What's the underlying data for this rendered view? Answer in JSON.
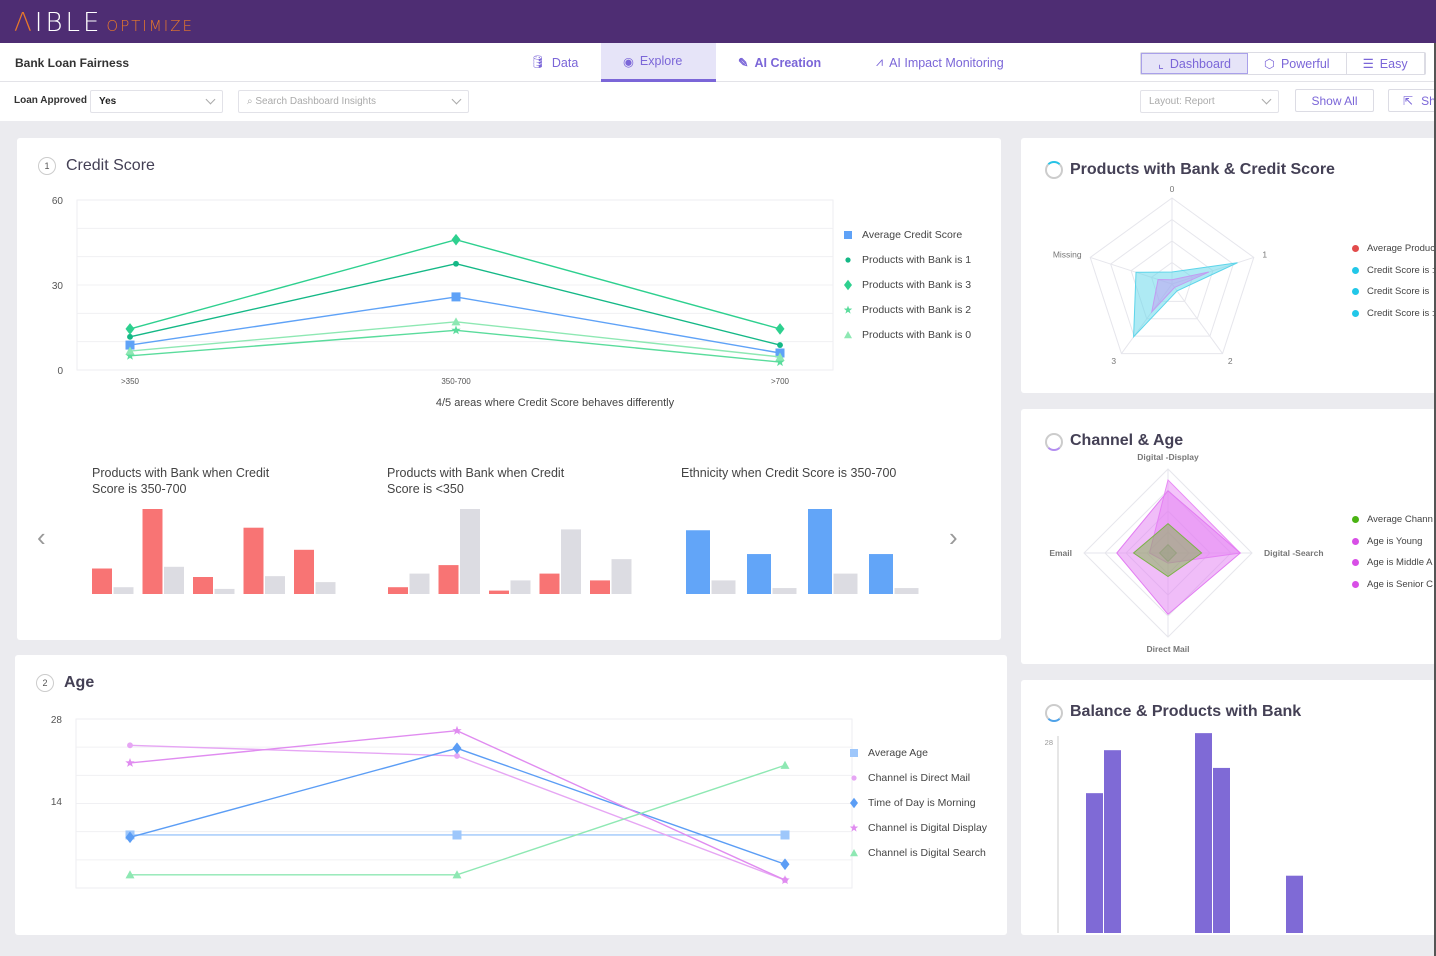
{
  "app": {
    "logo_main": "AIBLE",
    "logo_sub": "OPTIMIZE",
    "project": "Bank Loan Fairness"
  },
  "nav": [
    {
      "label": "Data",
      "icon": "database-icon"
    },
    {
      "label": "Explore",
      "icon": "compass-icon",
      "active": true
    },
    {
      "label": "AI Creation",
      "icon": "magic-wand-icon"
    },
    {
      "label": "AI Impact Monitoring",
      "icon": "pulse-icon"
    }
  ],
  "modes": [
    {
      "label": "Dashboard",
      "active": true
    },
    {
      "label": "Powerful"
    },
    {
      "label": "Easy"
    }
  ],
  "filters": {
    "label": "Loan Approved",
    "value": "Yes",
    "search_placeholder": "Search Dashboard Insights",
    "layout": "Layout: Report",
    "show_all": "Show All",
    "share": "Sh"
  },
  "colors": {
    "header": "#4e2d73",
    "accent": "#7b66d8",
    "accent_orange": "#e8782a"
  },
  "credit": {
    "num": "1",
    "title": "Credit Score",
    "subtitle": "4/5 areas where Credit Score behaves differently",
    "mini": [
      {
        "title1": "Products with Bank when Credit",
        "title2": "Score is 350-700"
      },
      {
        "title1": "Products with Bank when Credit",
        "title2": "Score is <350"
      },
      {
        "title1": "Ethnicity when Credit Score is 350-700",
        "title2": ""
      }
    ]
  },
  "age": {
    "num": "2",
    "title": "Age"
  },
  "radar1": {
    "title": "Products with Bank & Credit Score",
    "legend": [
      "Average Produc",
      "Credit Score is :",
      "Credit Score is",
      "Credit Score is :"
    ]
  },
  "radar2": {
    "title": "Channel & Age",
    "legend": [
      "Average Chann",
      "Age is Young",
      "Age is Middle A",
      "Age is Senior C"
    ]
  },
  "balance": {
    "title": "Balance & Products with Bank"
  },
  "chart_data": [
    {
      "type": "line",
      "ylim": [
        0,
        60
      ],
      "yticks": [
        "60",
        "30",
        "0"
      ],
      "categories": [
        ">350",
        "350-700",
        ">700"
      ],
      "series": [
        {
          "name": "Average Credit Score",
          "marker": "square",
          "color": "#5fa2f7",
          "values": [
            8.8,
            25.8,
            6
          ]
        },
        {
          "name": "Products with Bank is 1",
          "marker": "circle",
          "color": "#14b886",
          "values": [
            11.7,
            37.5,
            8.8
          ]
        },
        {
          "name": "Products with Bank is 3",
          "marker": "diamond",
          "color": "#2ed08f",
          "values": [
            14.5,
            46,
            14.5
          ]
        },
        {
          "name": "Products with Bank is 2",
          "marker": "star",
          "color": "#5adc9c",
          "values": [
            5,
            14,
            2.8
          ]
        },
        {
          "name": "Products with Bank is 0",
          "marker": "triangle",
          "color": "#8ee8b3",
          "values": [
            6.7,
            17,
            4.6
          ]
        }
      ]
    },
    {
      "type": "bar",
      "series": [
        {
          "color": "#f87474",
          "values": [
            30,
            100,
            20,
            78,
            52
          ]
        },
        {
          "color": "#dcdce2",
          "values": [
            8,
            32,
            6,
            21,
            14
          ]
        }
      ]
    },
    {
      "type": "bar",
      "series": [
        {
          "color": "#f87474",
          "values": [
            8,
            34,
            4,
            24,
            16
          ]
        },
        {
          "color": "#dcdce2",
          "values": [
            24,
            100,
            16,
            76,
            41
          ]
        }
      ]
    },
    {
      "type": "bar",
      "series": [
        {
          "color": "#62a5f8",
          "values": [
            75,
            47,
            100,
            47
          ]
        },
        {
          "color": "#dcdce2",
          "values": [
            16,
            7,
            24,
            7
          ]
        }
      ]
    },
    {
      "type": "line",
      "ylim": [
        0,
        28
      ],
      "yticks": [
        "28",
        "14"
      ],
      "categories": [
        "",
        "",
        ""
      ],
      "series": [
        {
          "name": "Average Age",
          "marker": "square",
          "color": "#9ec7fb",
          "values": [
            8.2,
            8.2,
            8.2
          ]
        },
        {
          "name": "Channel is Direct Mail",
          "marker": "circle",
          "color": "#e6a6f4",
          "values": [
            23.5,
            21.7,
            0.5
          ]
        },
        {
          "name": "Time of Day is Morning",
          "marker": "diamond",
          "color": "#5b9df5",
          "values": [
            7.8,
            23,
            3.2
          ]
        },
        {
          "name": "Channel is Digital Display",
          "marker": "star",
          "color": "#e08cf0",
          "values": [
            20.5,
            26,
            0.5
          ]
        },
        {
          "name": "Channel is Digital Search",
          "marker": "triangle",
          "color": "#8ee8b3",
          "values": [
            1.4,
            1.4,
            20.1
          ]
        }
      ]
    },
    {
      "type": "radar",
      "axes": [
        "0",
        "1",
        "2",
        "3",
        "Missing"
      ],
      "series": [
        {
          "color": "#5dd5ea",
          "values": [
            0.14,
            0.8,
            0.1,
            0.76,
            0.44
          ]
        },
        {
          "color": "#c29cf2",
          "values": [
            0.05,
            0.45,
            0.05,
            0.4,
            0.17
          ]
        }
      ],
      "legend_colors": [
        "#e24c4c",
        "#22c7e8",
        "#22c7e8",
        "#22c7e8"
      ]
    },
    {
      "type": "radar",
      "axes": [
        "Digital -Display",
        "Digital -Search",
        "Direct Mail",
        "Email"
      ],
      "series": [
        {
          "color": "#e98af6",
          "values": [
            0.87,
            0.86,
            0.12,
            0.22
          ]
        },
        {
          "color": "#e27cf2",
          "values": [
            0.74,
            0.86,
            0.73,
            0.61
          ]
        },
        {
          "color": "#b28fb8",
          "values": [
            0.1,
            0.1,
            0.1,
            0.1
          ]
        },
        {
          "color": "#7db24a",
          "values": [
            0.35,
            0.4,
            0.28,
            0.41
          ]
        }
      ],
      "legend_colors": [
        "#4ab313",
        "#d84fe6",
        "#d84fe6",
        "#d84fe6"
      ]
    },
    {
      "type": "bar",
      "yticks": [
        "28"
      ],
      "values": [
        20.5,
        26.8,
        29.3,
        24.2,
        8.4
      ],
      "color": "#7f6ad6"
    }
  ]
}
